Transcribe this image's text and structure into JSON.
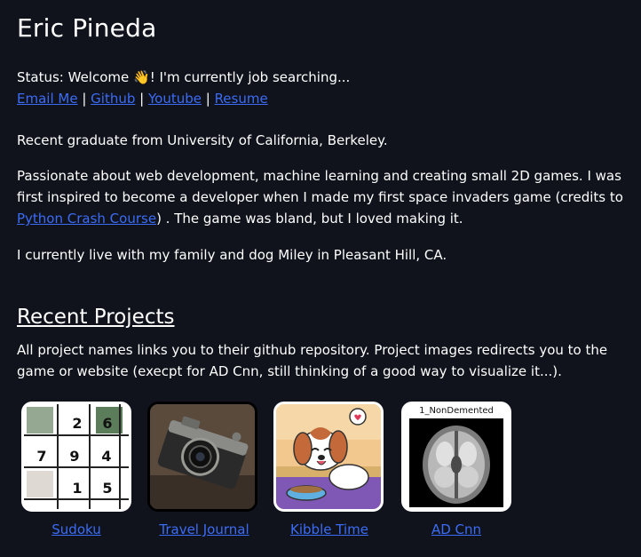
{
  "header": {
    "name": "Eric Pineda"
  },
  "status": {
    "prefix": "Status: Welcome ",
    "emoji": "👋",
    "suffix": "! I'm currently job searching..."
  },
  "links": {
    "email": "Email Me",
    "github": "Github",
    "youtube": "Youtube",
    "resume": "Resume",
    "separator": " | "
  },
  "bio": {
    "line1": "Recent graduate from University of California, Berkeley.",
    "para2_start": "Passionate about web development, machine learning and creating small 2D games. I was first inspired to become a developer when I made my first space invaders game (credits to ",
    "para2_link": "Python Crash Course",
    "para2_end": ") . The game was bland, but I loved making it.",
    "line3": "I currently live with my family and dog Miley in Pleasant Hill, CA."
  },
  "projects": {
    "heading": "Recent Projects",
    "description": "All project names links you to their github repository. Project images redirects you to the game or website (execpt for AD Cnn, still thinking of a good way to visualize it...).",
    "items": [
      {
        "name": "Sudoku"
      },
      {
        "name": "Travel Journal"
      },
      {
        "name": "Kibble Time"
      },
      {
        "name": "AD Cnn",
        "image_caption": "1_NonDemented"
      }
    ],
    "sudoku_cells": [
      {
        "row": 0,
        "col": 2,
        "value": "2"
      },
      {
        "row": 0,
        "col": 3,
        "value": "6"
      },
      {
        "row": 1,
        "col": 0,
        "value": "7"
      },
      {
        "row": 1,
        "col": 1,
        "value": "9"
      },
      {
        "row": 1,
        "col": 2,
        "value": "4"
      },
      {
        "row": 2,
        "col": 2,
        "value": "1"
      },
      {
        "row": 2,
        "col": 3,
        "value": "5"
      }
    ]
  },
  "colors": {
    "background": "#10131c",
    "link": "#3b6cf7",
    "text": "#ffffff"
  }
}
